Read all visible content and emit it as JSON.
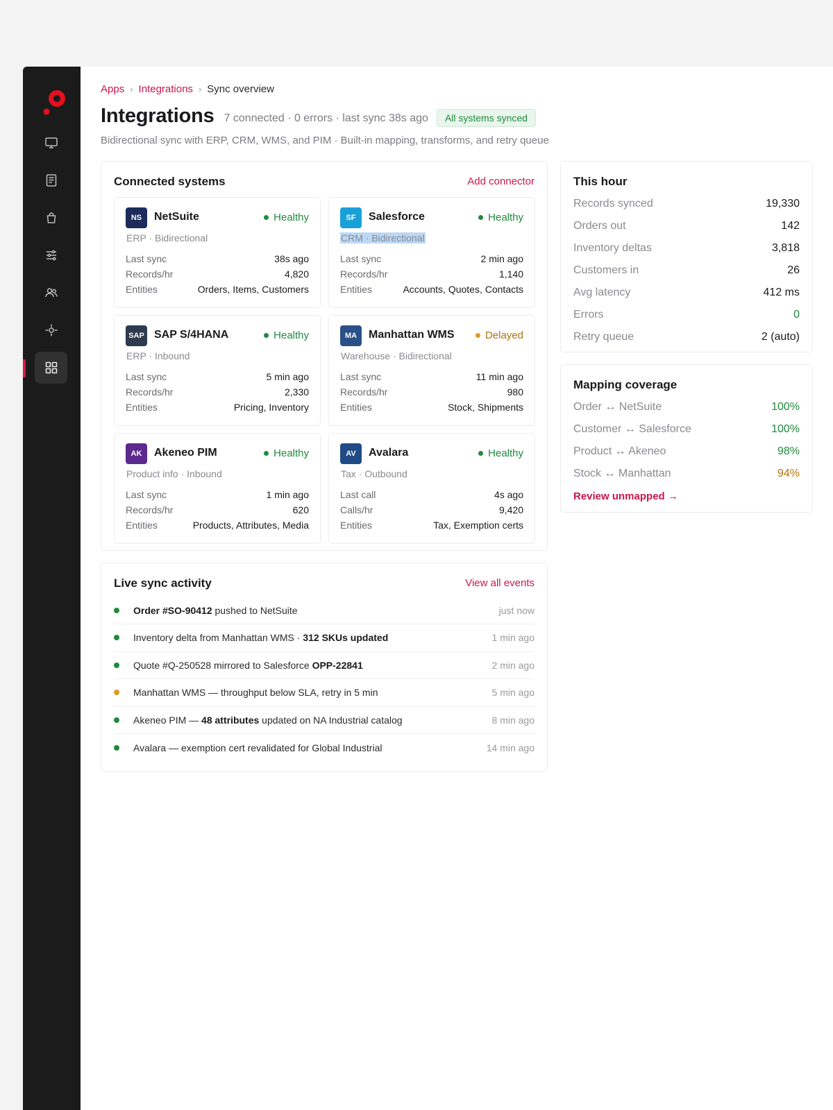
{
  "colors": {
    "accent": "#c8174b",
    "healthy": "#1f8a3e",
    "delayed": "#e09a26",
    "sidebar": "#1b1b1b"
  },
  "sidebar": {
    "logo": "brand-logo",
    "items": [
      {
        "icon": "monitor-icon"
      },
      {
        "icon": "document-icon"
      },
      {
        "icon": "shopping-bag-icon"
      },
      {
        "icon": "sliders-icon"
      },
      {
        "icon": "users-icon"
      },
      {
        "icon": "crosshair-icon"
      },
      {
        "icon": "grid-icon",
        "active": true
      }
    ]
  },
  "breadcrumb": {
    "items": [
      "Apps",
      "Integrations"
    ],
    "current": "Sync overview",
    "separator": "›"
  },
  "header": {
    "title": "Integrations",
    "meta": "7 connected · 0 errors · last sync 38s ago",
    "status": "All systems synced",
    "subtitle": "Bidirectional sync with ERP, CRM, WMS, and PIM · Built-in mapping, transforms, and retry queue"
  },
  "connected": {
    "title": "Connected systems",
    "action": "Add connector",
    "cards": [
      {
        "abbr": "NS",
        "color": "#1c2b5a",
        "name": "NetSuite",
        "status": "Healthy",
        "status_color": "#1f8a3e",
        "sub": "ERP · Bidirectional",
        "k1": "Last sync",
        "v1": "38s ago",
        "k2": "Records/hr",
        "v2": "4,820",
        "k3": "Entities",
        "v3": "Orders, Items, Customers"
      },
      {
        "abbr": "SF",
        "color": "#1aa0d8",
        "name": "Salesforce",
        "status": "Healthy",
        "status_color": "#1f8a3e",
        "sub": "CRM · Bidirectional",
        "k1": "Last sync",
        "v1": "2 min ago",
        "k2": "Records/hr",
        "v2": "1,140",
        "k3": "Entities",
        "v3": "Accounts, Quotes, Contacts"
      },
      {
        "abbr": "SAP",
        "color": "#2e3a4e",
        "name": "SAP S/4HANA",
        "status": "Healthy",
        "status_color": "#1f8a3e",
        "sub": "ERP · Inbound",
        "k1": "Last sync",
        "v1": "5 min ago",
        "k2": "Records/hr",
        "v2": "2,330",
        "k3": "Entities",
        "v3": "Pricing, Inventory"
      },
      {
        "abbr": "MA",
        "color": "#2a5088",
        "name": "Manhattan WMS",
        "status": "Delayed",
        "status_color": "#b3730d",
        "sub": "Warehouse · Bidirectional",
        "k1": "Last sync",
        "v1": "11 min ago",
        "k2": "Records/hr",
        "v2": "980",
        "k3": "Entities",
        "v3": "Stock, Shipments"
      },
      {
        "abbr": "AK",
        "color": "#5c2a8e",
        "name": "Akeneo PIM",
        "status": "Healthy",
        "status_color": "#1f8a3e",
        "sub": "Product info · Inbound",
        "k1": "Last sync",
        "v1": "1 min ago",
        "k2": "Records/hr",
        "v2": "620",
        "k3": "Entities",
        "v3": "Products, Attributes, Media"
      },
      {
        "abbr": "AV",
        "color": "#1f4a86",
        "name": "Avalara",
        "status": "Healthy",
        "status_color": "#1f8a3e",
        "sub": "Tax · Outbound",
        "k1": "Last call",
        "v1": "4s ago",
        "k2": "Calls/hr",
        "v2": "9,420",
        "k3": "Entities",
        "v3": "Tax, Exemption certs"
      }
    ]
  },
  "this_hour": {
    "title": "This hour",
    "rows": [
      {
        "label": "Records synced",
        "value": "19,330"
      },
      {
        "label": "Orders out",
        "value": "142"
      },
      {
        "label": "Inventory deltas",
        "value": "3,818"
      },
      {
        "label": "Customers in",
        "value": "26"
      },
      {
        "label": "Avg latency",
        "value": "412 ms"
      },
      {
        "label": "Errors",
        "value": "0",
        "color": "#1f8a3e"
      },
      {
        "label": "Retry queue",
        "value": "2 (auto)"
      }
    ]
  },
  "mapping": {
    "title": "Mapping coverage",
    "rows": [
      {
        "label": "Order ↔ NetSuite",
        "value": "100%",
        "color": "#1f8a3e"
      },
      {
        "label": "Customer ↔ Salesforce",
        "value": "100%",
        "color": "#1f8a3e"
      },
      {
        "label": "Product ↔ Akeneo",
        "value": "98%",
        "color": "#1f8a3e"
      },
      {
        "label": "Stock ↔ Manhattan",
        "value": "94%",
        "color": "#b3730d"
      }
    ],
    "link": "Review unmapped →"
  },
  "activity": {
    "title": "Live sync activity",
    "action": "View all events",
    "items": [
      {
        "parts": [
          {
            "t": "Order #SO-90412",
            "b": true
          },
          {
            "t": " pushed to NetSuite"
          }
        ],
        "time": "just now",
        "dot": "#1f8a3e"
      },
      {
        "parts": [
          {
            "t": "Inventory delta from Manhattan WMS · "
          },
          {
            "t": "312 SKUs updated",
            "b": true
          }
        ],
        "time": "1 min ago",
        "dot": "#1f8a3e"
      },
      {
        "parts": [
          {
            "t": "Quote #Q-250528 mirrored to Salesforce "
          },
          {
            "t": "OPP-22841",
            "b": true
          }
        ],
        "time": "2 min ago",
        "dot": "#1f8a3e"
      },
      {
        "parts": [
          {
            "t": "Manhattan WMS — throughput below SLA, retry in 5 min"
          }
        ],
        "time": "5 min ago",
        "dot": "#e09a26"
      },
      {
        "parts": [
          {
            "t": "Akeneo PIM — "
          },
          {
            "t": "48 attributes",
            "b": true
          },
          {
            "t": " updated on NA Industrial catalog"
          }
        ],
        "time": "8 min ago",
        "dot": "#1f8a3e"
      },
      {
        "parts": [
          {
            "t": "Avalara — exemption cert revalidated for Global Industrial"
          }
        ],
        "time": "14 min ago",
        "dot": "#1f8a3e"
      }
    ]
  }
}
